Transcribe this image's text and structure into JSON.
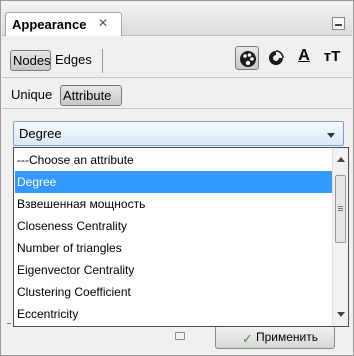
{
  "panel": {
    "title": "Appearance",
    "close_icon": "close-icon",
    "minimize_icon": "minimize-icon"
  },
  "element_tabs": {
    "nodes": "Nodes",
    "edges": "Edges"
  },
  "tools": {
    "color": "palette-icon",
    "size": "size-icon",
    "label_color_text": "A",
    "label_size_text": "тT"
  },
  "mode_tabs": {
    "unique": "Unique",
    "attribute": "Attribute"
  },
  "attribute_combo": {
    "selected": "Degree"
  },
  "dropdown": {
    "options": [
      "---Choose an attribute",
      "Degree",
      "Взвешенная мощность",
      "Closeness Centrality",
      "Number of triangles",
      "Eigenvector Centrality",
      "Clustering Coefficient",
      "Eccentricity"
    ],
    "selected_index": 1
  },
  "apply_button": {
    "label": "Применить"
  }
}
